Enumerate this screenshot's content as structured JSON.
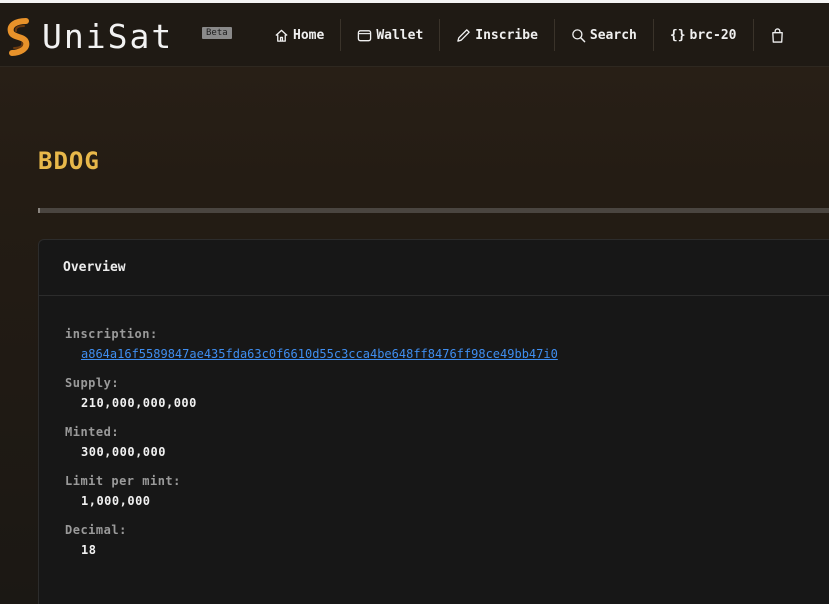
{
  "brand": {
    "name": "UniSat",
    "badge": "Beta"
  },
  "nav": [
    {
      "label": "Home",
      "icon": "home-icon"
    },
    {
      "label": "Wallet",
      "icon": "wallet-icon"
    },
    {
      "label": "Inscribe",
      "icon": "pencil-icon"
    },
    {
      "label": "Search",
      "icon": "search-icon"
    },
    {
      "label": "brc-20",
      "icon": "braces-icon"
    },
    {
      "label": "",
      "icon": "shopping-bag-icon"
    }
  ],
  "page": {
    "title": "BDOG"
  },
  "overview": {
    "heading": "Overview",
    "fields": [
      {
        "label": "inscription",
        "value": "a864a16f5589847ae435fda63c0f6610d55c3cca4be648ff8476ff98ce49bb47i0"
      },
      {
        "label": "Supply",
        "value": "210,000,000,000"
      },
      {
        "label": "Minted",
        "value": "300,000,000"
      },
      {
        "label": "Limit per mint",
        "value": "1,000,000"
      },
      {
        "label": "Decimal",
        "value": "18"
      }
    ]
  },
  "colors": {
    "accent": "#e8b84a",
    "link": "#3f8ef0",
    "background": "#1a1612"
  }
}
